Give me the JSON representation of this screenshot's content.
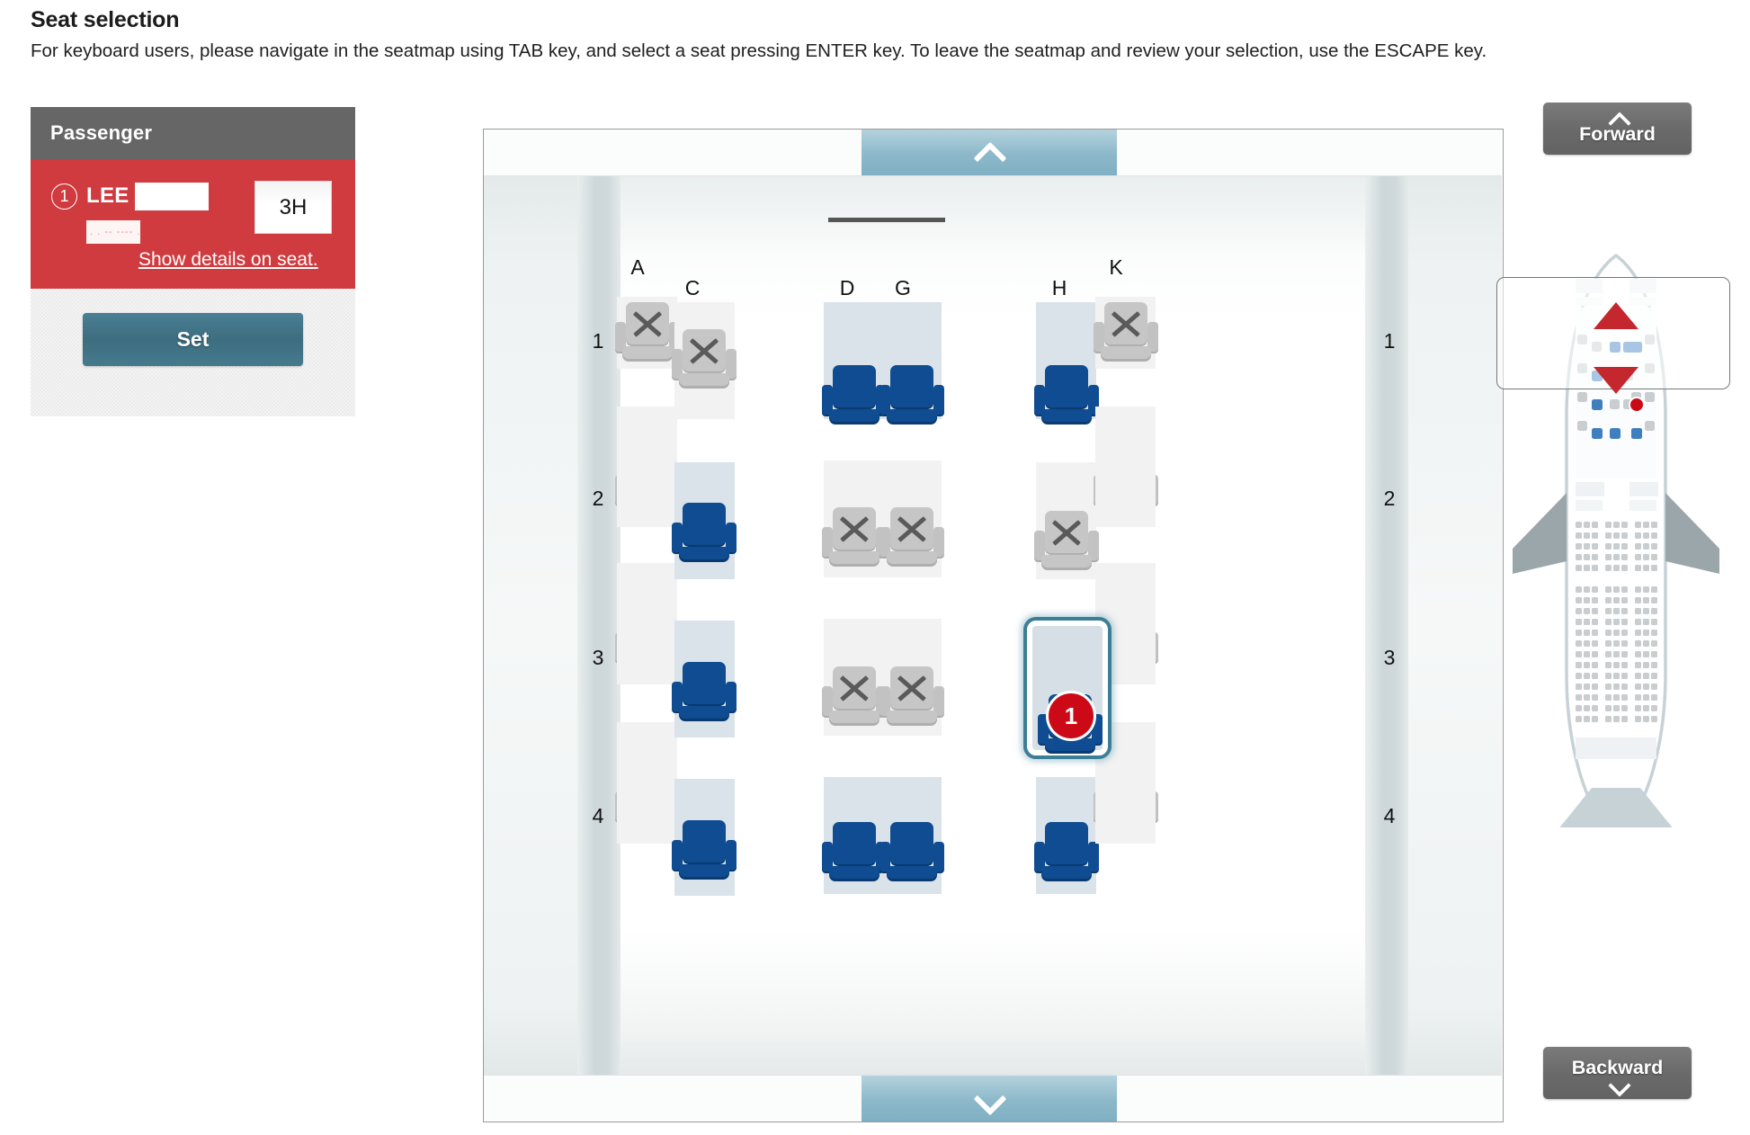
{
  "header": {
    "title": "Seat selection",
    "instructions": "For keyboard users, please navigate in the seatmap using TAB key, and select a seat pressing ENTER key. To leave the seatmap and review your selection, use the ESCAPE key."
  },
  "passenger_panel": {
    "header_label": "Passenger",
    "number": "1",
    "surname": "LEE",
    "name_redacted": "",
    "sub_redacted": ". . -- ---- . --",
    "seat_badge": "3H",
    "details_link": "Show details on seat.",
    "set_button": "Set"
  },
  "seatmap": {
    "scroll_up_icon": "chevron-up-icon",
    "scroll_down_icon": "chevron-down-icon",
    "column_letters": [
      "A",
      "C",
      "D",
      "G",
      "H",
      "K"
    ],
    "row_numbers": [
      "1",
      "2",
      "3",
      "4"
    ],
    "selected_seat": "3H",
    "selected_marker": "1",
    "seats": [
      {
        "id": "1A",
        "row": "1",
        "col": "A",
        "state": "unavailable"
      },
      {
        "id": "1C",
        "row": "1",
        "col": "C",
        "state": "unavailable"
      },
      {
        "id": "1D",
        "row": "1",
        "col": "D",
        "state": "available"
      },
      {
        "id": "1G",
        "row": "1",
        "col": "G",
        "state": "available"
      },
      {
        "id": "1H",
        "row": "1",
        "col": "H",
        "state": "available"
      },
      {
        "id": "1K",
        "row": "1",
        "col": "K",
        "state": "unavailable"
      },
      {
        "id": "2A",
        "row": "2",
        "col": "A",
        "state": "unavailable"
      },
      {
        "id": "2C",
        "row": "2",
        "col": "C",
        "state": "available"
      },
      {
        "id": "2D",
        "row": "2",
        "col": "D",
        "state": "unavailable"
      },
      {
        "id": "2G",
        "row": "2",
        "col": "G",
        "state": "unavailable"
      },
      {
        "id": "2H",
        "row": "2",
        "col": "H",
        "state": "unavailable"
      },
      {
        "id": "2K",
        "row": "2",
        "col": "K",
        "state": "unavailable"
      },
      {
        "id": "3A",
        "row": "3",
        "col": "A",
        "state": "unavailable"
      },
      {
        "id": "3C",
        "row": "3",
        "col": "C",
        "state": "available"
      },
      {
        "id": "3D",
        "row": "3",
        "col": "D",
        "state": "unavailable"
      },
      {
        "id": "3G",
        "row": "3",
        "col": "G",
        "state": "unavailable"
      },
      {
        "id": "3H",
        "row": "3",
        "col": "H",
        "state": "selected"
      },
      {
        "id": "3K",
        "row": "3",
        "col": "K",
        "state": "unavailable"
      },
      {
        "id": "4A",
        "row": "4",
        "col": "A",
        "state": "unavailable"
      },
      {
        "id": "4C",
        "row": "4",
        "col": "C",
        "state": "available"
      },
      {
        "id": "4D",
        "row": "4",
        "col": "D",
        "state": "available"
      },
      {
        "id": "4G",
        "row": "4",
        "col": "G",
        "state": "available"
      },
      {
        "id": "4H",
        "row": "4",
        "col": "H",
        "state": "available"
      },
      {
        "id": "4K",
        "row": "4",
        "col": "K",
        "state": "unavailable"
      }
    ]
  },
  "navigation": {
    "forward_label": "Forward",
    "backward_label": "Backward",
    "forward_icon": "chevron-up-icon",
    "backward_icon": "chevron-down-icon"
  },
  "minimap": {
    "name": "aircraft-overview-diagram",
    "viewport_indicator": "current-view-region",
    "scroll_hint_up": "red-triangle-up",
    "scroll_hint_down": "red-triangle-down"
  },
  "colors": {
    "passenger_red": "#cf3b3f",
    "header_gray": "#666666",
    "set_teal": "#3d6d80",
    "seat_blue": "#0f4c91",
    "seat_gray": "#c6c6c6",
    "marker_red": "#cc0a17",
    "selection_outline": "#3c7e96"
  }
}
